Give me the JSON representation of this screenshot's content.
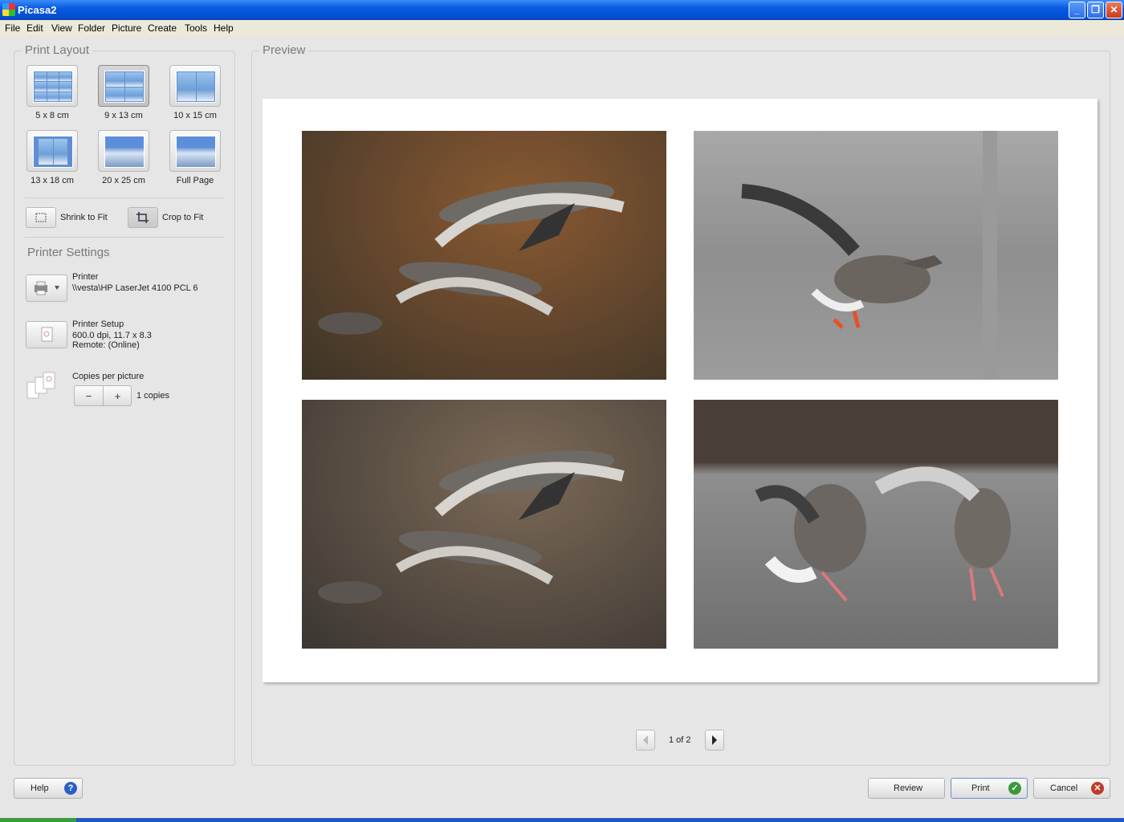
{
  "window": {
    "title": "Picasa2",
    "minimize_glyph": "_",
    "restore_glyph": "❐",
    "close_glyph": "✕"
  },
  "menu": [
    "File",
    "Edit",
    "View",
    "Folder",
    "Picture",
    "Create",
    "Tools",
    "Help"
  ],
  "print_layout": {
    "legend": "Print Layout",
    "options": [
      {
        "label": "5 x 8 cm",
        "icon": "grid-6-icon"
      },
      {
        "label": "9 x 13 cm",
        "icon": "grid-4-icon",
        "selected": true
      },
      {
        "label": "10 x 15 cm",
        "icon": "grid-2-icon"
      },
      {
        "label": "13 x 18 cm",
        "icon": "grid-2-small-icon"
      },
      {
        "label": "20 x 25 cm",
        "icon": "mountain-icon"
      },
      {
        "label": "Full Page",
        "icon": "mountain-full-icon"
      }
    ],
    "shrink_to_fit": "Shrink to Fit",
    "crop_to_fit": "Crop to Fit"
  },
  "printer_settings": {
    "legend": "Printer Settings",
    "printer_label": "Printer",
    "printer_name": "\\\\vesta\\HP LaserJet 4100 PCL 6",
    "setup_label": "Printer Setup",
    "setup_line1": "600.0 dpi, 11.7 x 8.3",
    "setup_line2": "Remote:  (Online)",
    "copies_label": "Copies per picture",
    "minus": "−",
    "plus": "+",
    "copies_value": "1 copies"
  },
  "preview": {
    "legend": "Preview",
    "page_indicator": "1 of 2"
  },
  "footer": {
    "help": "Help",
    "review": "Review",
    "print": "Print",
    "cancel": "Cancel",
    "help_glyph": "?",
    "print_glyph": "✓",
    "cancel_glyph": "✕"
  },
  "colors": {
    "titlebar": "#0a5ae0",
    "help_icon": "#2a5fc9",
    "print_check": "#3a9a3a",
    "cancel_x": "#c0392b"
  }
}
